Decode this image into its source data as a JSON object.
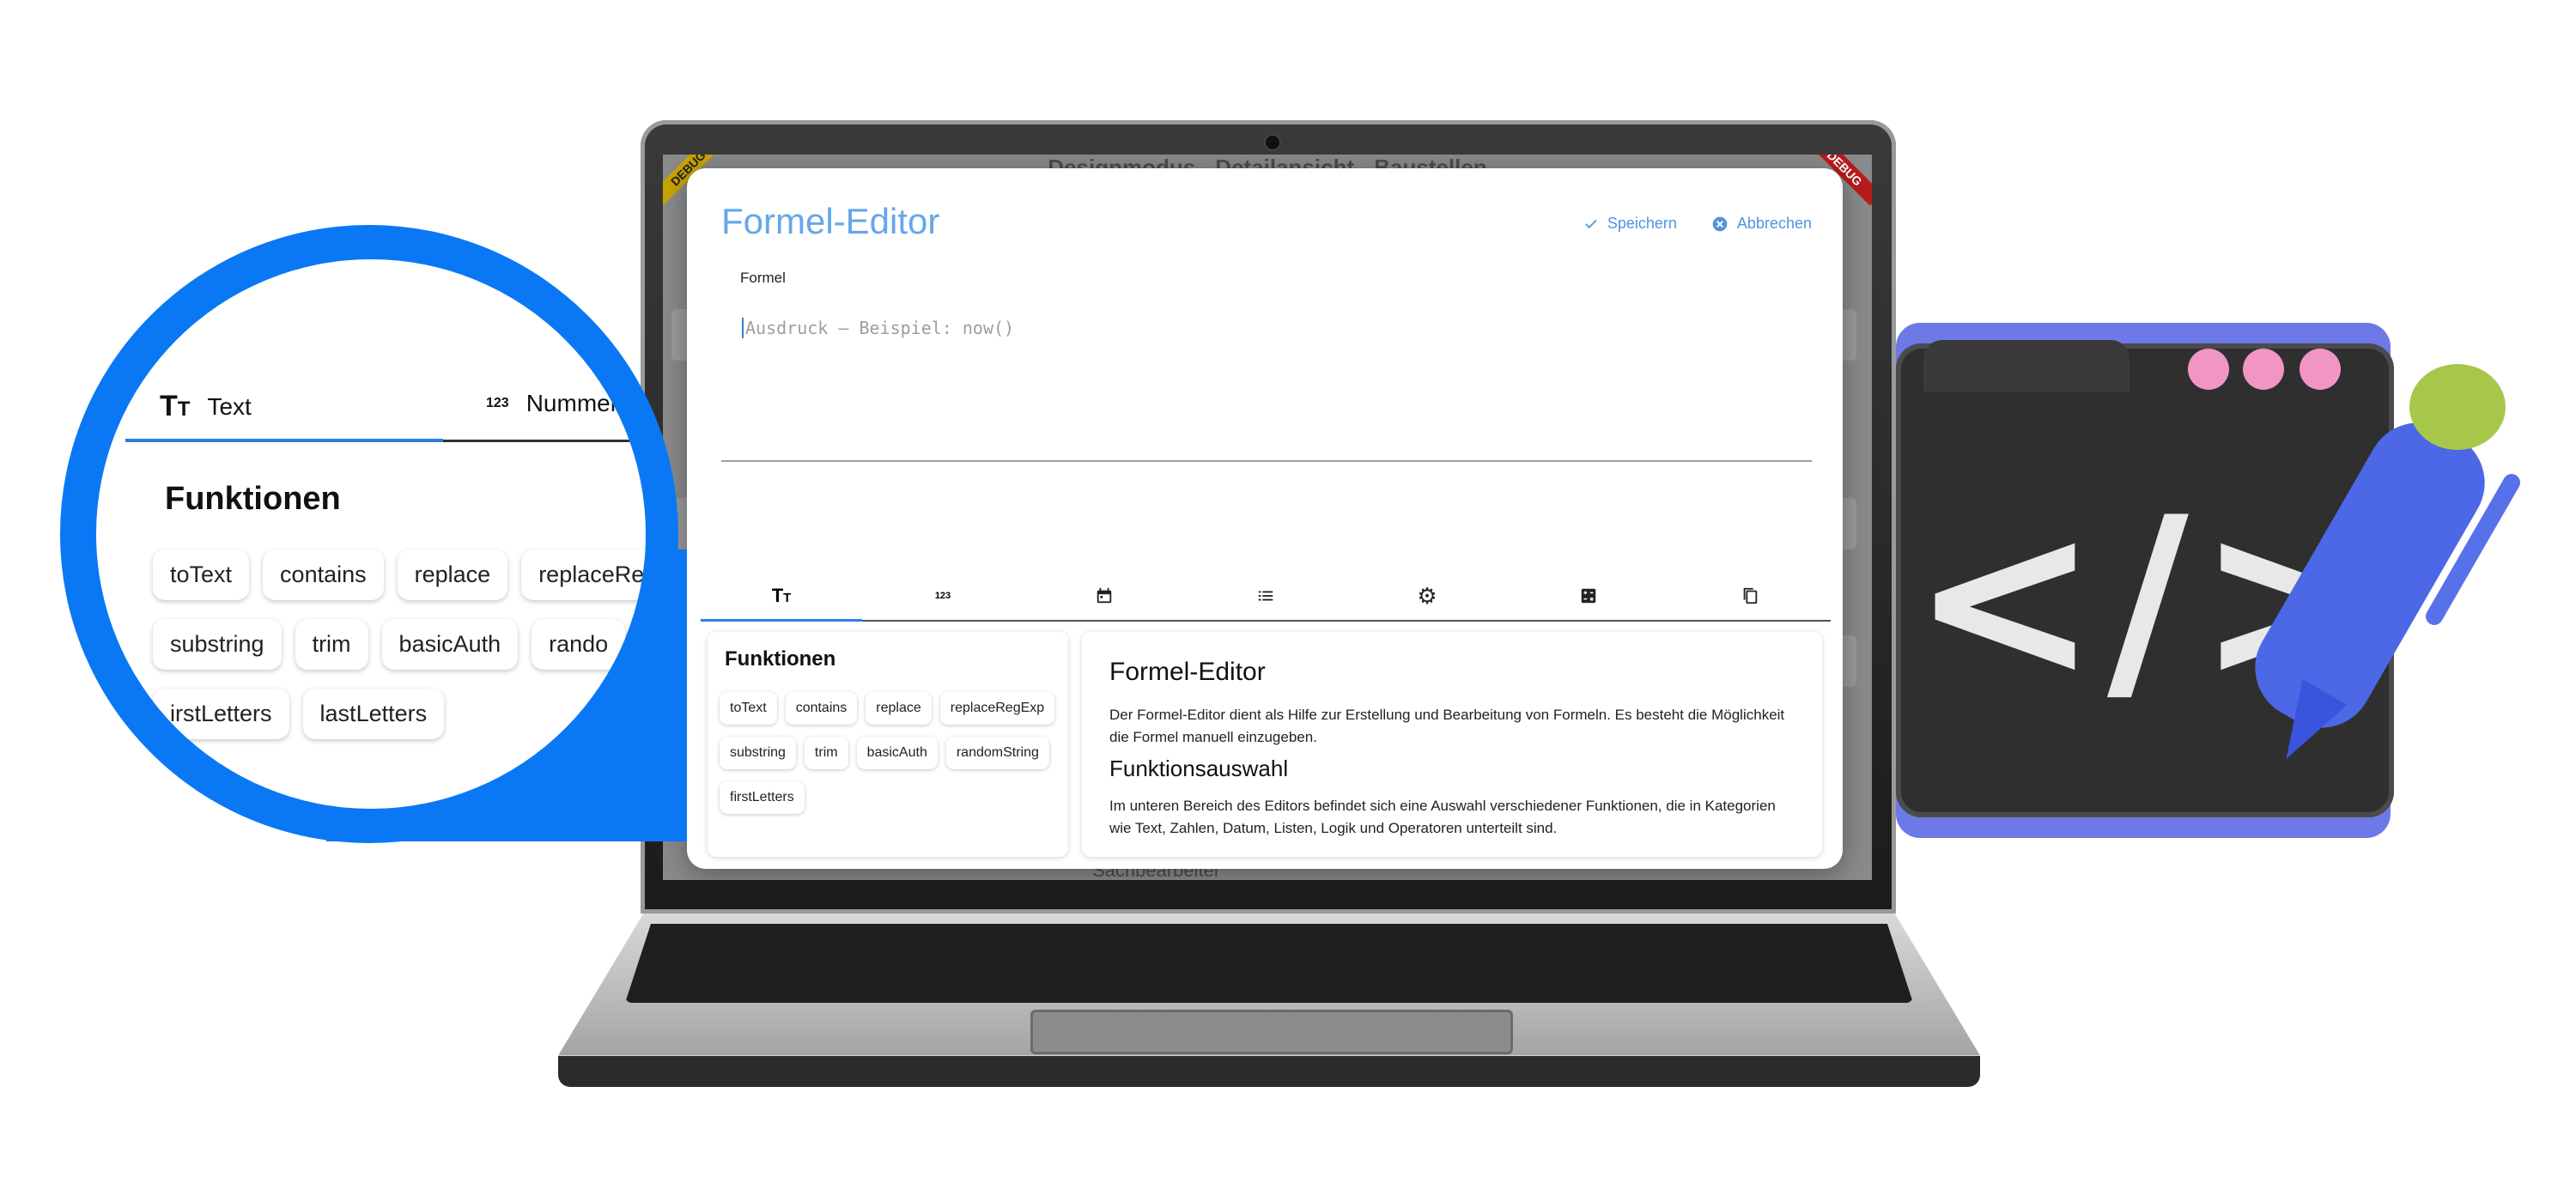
{
  "background_app": {
    "title": "Designmodus - Detailansicht - Baustellen",
    "footer_text": "Sachbearbeiter",
    "debug_label": "DEBUG"
  },
  "dialog": {
    "title": "Formel-Editor",
    "save_label": "Speichern",
    "cancel_label": "Abbrechen",
    "formula_label": "Formel",
    "formula_placeholder": "Ausdruck – Beispiel: now()",
    "tabs": [
      {
        "icon": "text-format-icon",
        "glyph": "Tт",
        "active": true
      },
      {
        "icon": "numbers-icon",
        "glyph": "123"
      },
      {
        "icon": "calendar-icon",
        "glyph": "▦"
      },
      {
        "icon": "list-icon",
        "glyph": "☰"
      },
      {
        "icon": "gear-icon",
        "glyph": "⚙"
      },
      {
        "icon": "calculator-icon",
        "glyph": "⊞"
      },
      {
        "icon": "copy-icon",
        "glyph": "❐"
      }
    ],
    "functions_heading": "Funktionen",
    "functions": [
      "toText",
      "contains",
      "replace",
      "replaceRegExp",
      "substring",
      "trim",
      "basicAuth",
      "randomString",
      "firstLetters"
    ],
    "help_title": "Formel-Editor",
    "help_text": "Der Formel-Editor dient als Hilfe zur Erstellung und Bearbeitung von Formeln. Es besteht die Möglichkeit die Formel manuell einzugeben.",
    "help_subtitle": "Funktionsauswahl",
    "help_subtext": "Im unteren Bereich des Editors befindet sich eine Auswahl verschiedener Funktionen, die in Kategorien wie Text, Zahlen, Datum, Listen, Logik und Operatoren unterteilt sind."
  },
  "magnifier": {
    "tab_text": "Text",
    "tab_number_glyph": "123",
    "tab_number": "Nummer",
    "heading": "Funktionen",
    "functions": [
      "toText",
      "contains",
      "replace",
      "replaceRe",
      "substring",
      "trim",
      "basicAuth",
      "rando",
      "irstLetters",
      "lastLetters"
    ]
  },
  "colors": {
    "accent": "#64a7ea",
    "magnifier": "#0a78f5",
    "folder": "#6d79e6",
    "pink_dot": "#f195c4",
    "pen_cap": "#a7c74a"
  }
}
